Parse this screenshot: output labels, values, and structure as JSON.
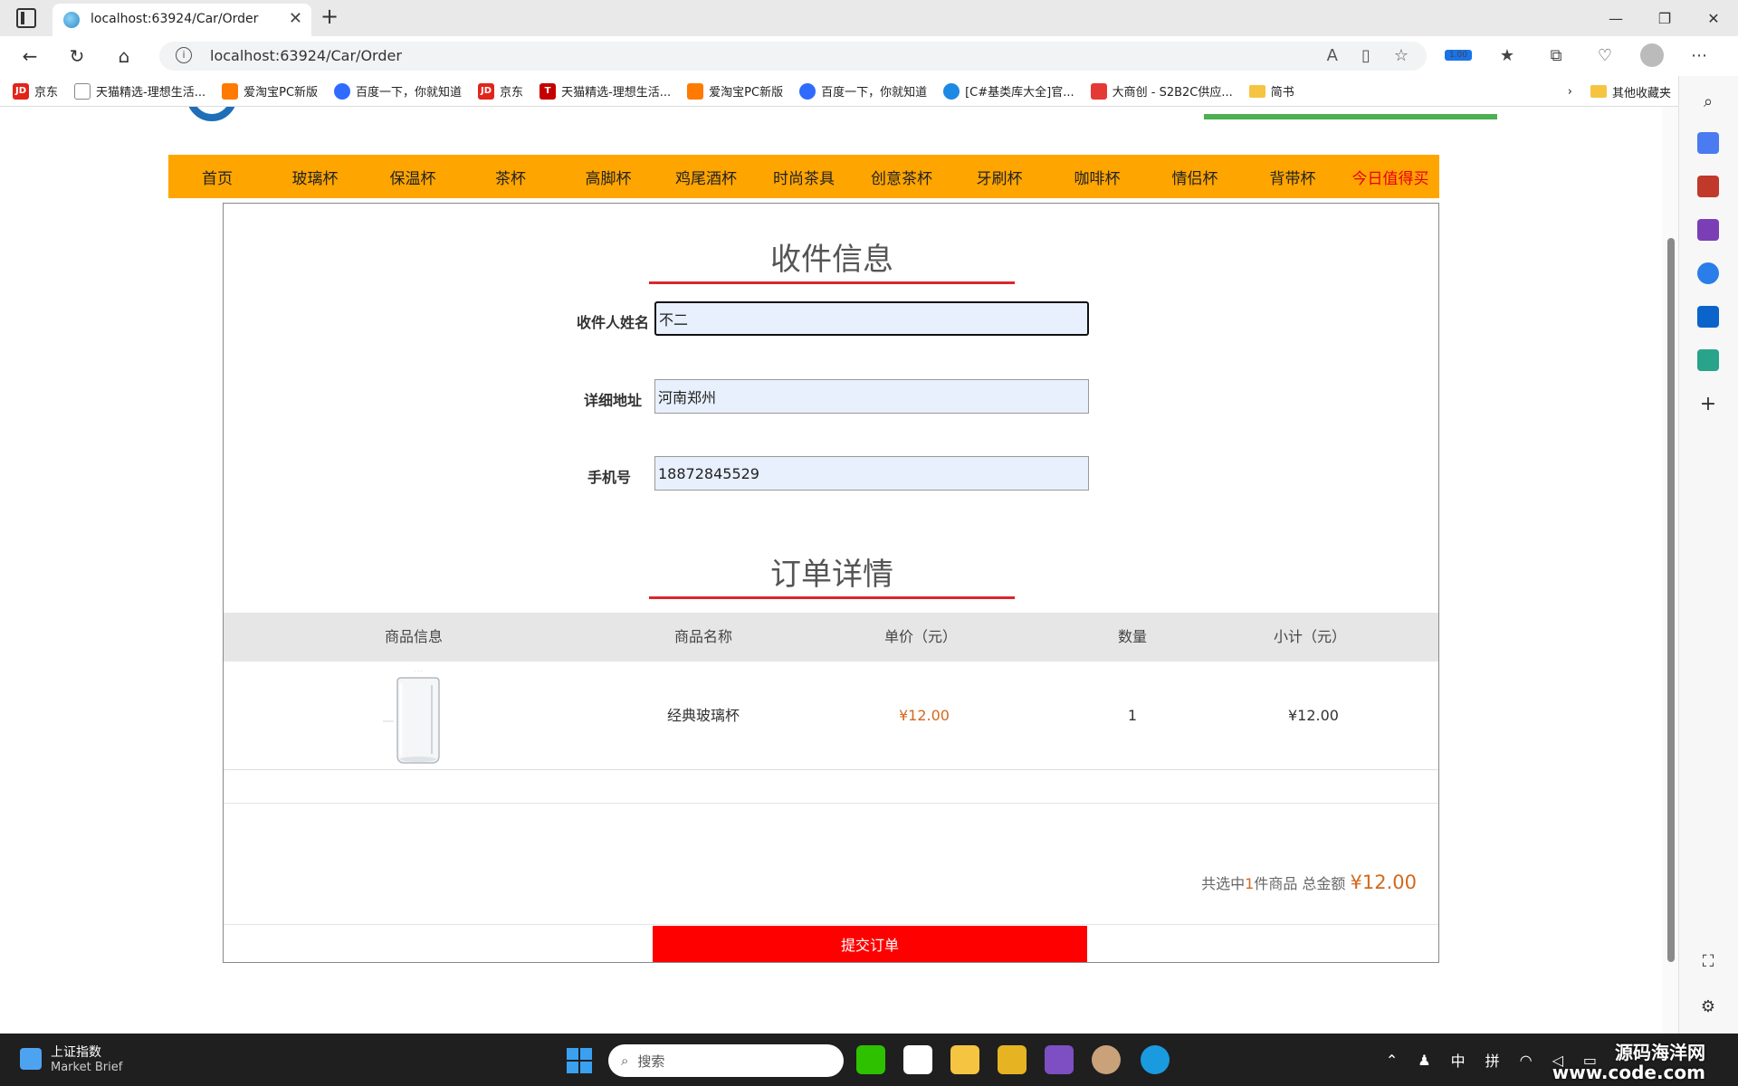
{
  "browser": {
    "tab_title": "localhost:63924/Car/Order",
    "url": "localhost:63924/Car/Order",
    "extension_badge": "1.00"
  },
  "bookmarks": [
    {
      "label": "京东",
      "icon": "JD",
      "color": "#e1251b"
    },
    {
      "label": "天猫精选-理想生活...",
      "icon": "",
      "color": "#888888"
    },
    {
      "label": "爱淘宝PC新版",
      "icon": "",
      "color": "#ff7a00"
    },
    {
      "label": "百度一下，你就知道",
      "icon": "",
      "color": "#2f6bff"
    },
    {
      "label": "京东",
      "icon": "JD",
      "color": "#e1251b"
    },
    {
      "label": "天猫精选-理想生活...",
      "icon": "T",
      "color": "#c40000"
    },
    {
      "label": "爱淘宝PC新版",
      "icon": "",
      "color": "#ff7a00"
    },
    {
      "label": "百度一下，你就知道",
      "icon": "",
      "color": "#2f6bff"
    },
    {
      "label": "[C#基类库大全]官...",
      "icon": "",
      "color": "#1e88e5"
    },
    {
      "label": "大商创 - S2B2C供应...",
      "icon": "",
      "color": "#e53935"
    },
    {
      "label": "简书",
      "icon": "",
      "color": "#f5c542"
    }
  ],
  "bookmarks_other": "其他收藏夹",
  "categories": [
    "首页",
    "玻璃杯",
    "保温杯",
    "茶杯",
    "高脚杯",
    "鸡尾酒杯",
    "时尚茶具",
    "创意茶杯",
    "牙刷杯",
    "咖啡杯",
    "情侣杯",
    "背带杯",
    "今日值得买"
  ],
  "shipping": {
    "title": "收件信息",
    "name_label": "收件人姓名",
    "name_value": "不二",
    "address_label": "详细地址",
    "address_value": "河南郑州",
    "phone_label": "手机号",
    "phone_value": "18872845529"
  },
  "order": {
    "title": "订单详情",
    "columns": [
      "商品信息",
      "商品名称",
      "单价（元）",
      "数量",
      "小计（元）"
    ],
    "rows": [
      {
        "name": "经典玻璃杯",
        "price": "¥12.00",
        "qty": "1",
        "subtotal": "¥12.00"
      }
    ],
    "summary_prefix": "共选中",
    "summary_count": "1",
    "summary_mid": "件商品 总金额",
    "summary_total": "¥12.00",
    "submit_label": "提交订单"
  },
  "taskbar": {
    "widget_title": "上证指数",
    "widget_sub": "Market Brief",
    "search_placeholder": "搜索",
    "ime_lang": "中",
    "ime_mode": "拼"
  },
  "watermark": {
    "line1": "源码海洋网",
    "line2": "www.code.com"
  },
  "colors": {
    "category_bar": "#ffa500",
    "accent_red": "#d9272e",
    "price": "#d2691e",
    "submit": "#ff0000"
  }
}
